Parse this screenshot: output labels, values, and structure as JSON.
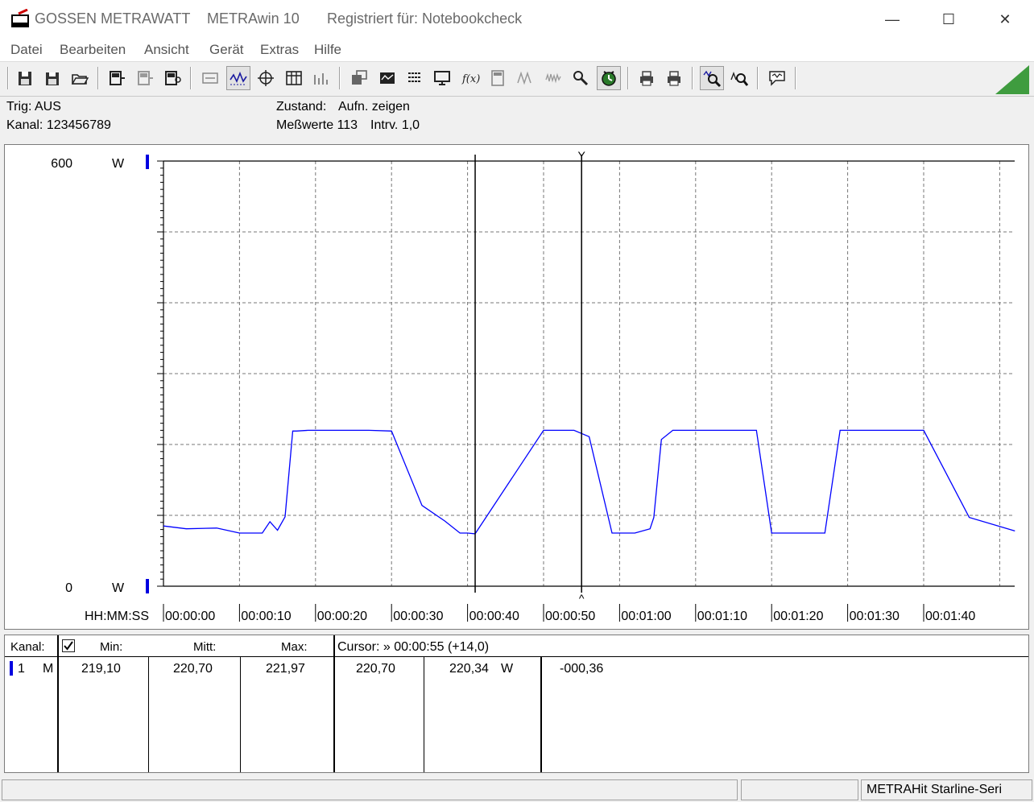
{
  "window": {
    "brand": "GOSSEN METRAWATT",
    "app": "METRAwin 10",
    "registered": "Registriert für: Notebookcheck",
    "minimize": "—",
    "maximize": "☐",
    "close": "✕"
  },
  "menu": [
    "Datei",
    "Bearbeiten",
    "Ansicht",
    "Gerät",
    "Extras",
    "Hilfe"
  ],
  "info": {
    "trig": "Trig: AUS",
    "kanal": "Kanal: 123456789",
    "zustand_label": "Zustand:",
    "zustand_value": "Aufn. zeigen",
    "messwerte": "Meßwerte 113",
    "intervall": "Intrv. 1,0"
  },
  "chart": {
    "y_top_label": "600",
    "y_bottom_label": "0",
    "unit_top": "W",
    "unit_bottom": "W",
    "time_format_label": "HH:MM:SS",
    "x_tick_labels": [
      "00:00:00",
      "00:00:10",
      "00:00:20",
      "00:00:30",
      "00:00:40",
      "00:00:50",
      "00:01:00",
      "00:01:10",
      "00:01:20",
      "00:01:30",
      "00:01:40"
    ],
    "line_color": "#0000ff",
    "cursor_marker_top": "Y",
    "cursor_marker_bottom": "^"
  },
  "chart_data": {
    "type": "line",
    "ylim": [
      0,
      600
    ],
    "xlim": [
      0,
      112
    ],
    "x_unit": "s",
    "y_unit": "W",
    "cursor_positions_s": [
      41,
      55
    ],
    "series": [
      {
        "x": [
          0,
          3,
          7,
          10,
          13,
          14,
          15,
          16,
          17,
          17.5,
          19,
          25,
          27,
          30,
          34,
          37,
          39,
          40,
          41,
          50,
          53,
          54,
          56,
          59,
          62,
          64,
          64.5,
          65.5,
          67,
          71,
          78,
          80,
          84,
          87,
          89,
          95,
          97,
          98,
          100,
          106,
          112
        ],
        "y": [
          85,
          81,
          82,
          75,
          75,
          91,
          79,
          98,
          219,
          219,
          220,
          220,
          220,
          219,
          114,
          92,
          75,
          75,
          74,
          220,
          220,
          220,
          211,
          75,
          75,
          81,
          97,
          207,
          220,
          220,
          220,
          75,
          75,
          75,
          220,
          220,
          220,
          220,
          220,
          97,
          78
        ]
      }
    ]
  },
  "table": {
    "kanal_header": "Kanal:",
    "min_header": "Min:",
    "mitt_header": "Mitt:",
    "max_header": "Max:",
    "cursor_header": "Cursor: » 00:00:55 (+14,0)",
    "row": {
      "channel": "1",
      "mode": "M",
      "min": "219,10",
      "mitt": "220,70",
      "max": "221,97",
      "cursor1": "220,70",
      "cursor2": "220,34",
      "unit": "W",
      "delta": "-000,36"
    }
  },
  "status": {
    "device": "METRAHit Starline-Seri"
  }
}
